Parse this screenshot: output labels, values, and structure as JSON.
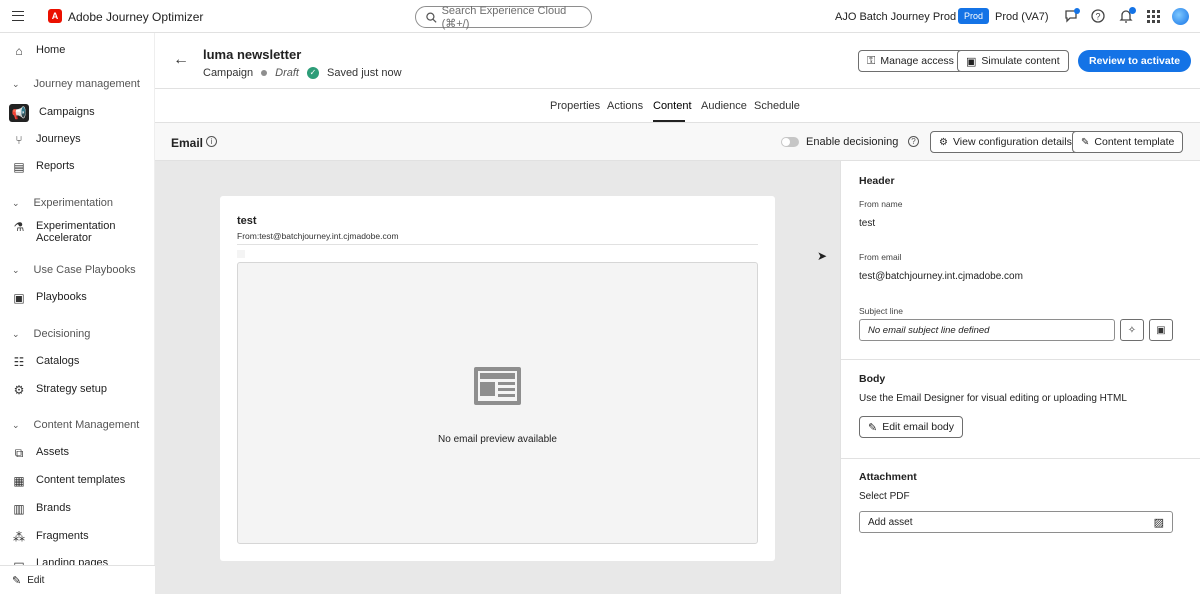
{
  "app": {
    "title": "Adobe Journey Optimizer",
    "search_placeholder": "Search Experience Cloud (⌘+/)",
    "org_name": "AJO Batch Journey Prod",
    "env_badge": "Prod",
    "env_name": "Prod (VA7)"
  },
  "sidebar": {
    "items": {
      "home": "Home",
      "group_journey": "Journey management",
      "campaigns": "Campaigns",
      "journeys": "Journeys",
      "reports": "Reports",
      "group_experimentation": "Experimentation",
      "experimentation_accelerator": "Experimentation Accelerator",
      "group_playbooks": "Use Case Playbooks",
      "playbooks": "Playbooks",
      "group_decisioning": "Decisioning",
      "catalogs": "Catalogs",
      "strategy_setup": "Strategy setup",
      "group_content": "Content Management",
      "assets": "Assets",
      "content_templates": "Content templates",
      "brands": "Brands",
      "fragments": "Fragments",
      "landing_pages": "Landing pages"
    },
    "edit_label": "Edit"
  },
  "campaign": {
    "title": "luma newsletter",
    "type": "Campaign",
    "status": "Draft",
    "saved": "Saved just now"
  },
  "header_buttons": {
    "manage_access": "Manage access",
    "simulate_content": "Simulate content",
    "review": "Review to activate"
  },
  "tabs": [
    "Properties",
    "Actions",
    "Content",
    "Audience",
    "Schedule"
  ],
  "active_tab": "Content",
  "subheader": {
    "title": "Email",
    "decisioning_label": "Enable decisioning",
    "view_config": "View configuration details",
    "content_template": "Content template"
  },
  "email_preview": {
    "subject": "test",
    "from": "From:test@batchjourney.int.cjmadobe.com",
    "empty_text": "No email preview available"
  },
  "panel": {
    "header_title": "Header",
    "from_name_label": "From name",
    "from_name_value": "test",
    "from_email_label": "From email",
    "from_email_value": "test@batchjourney.int.cjmadobe.com",
    "subject_label": "Subject line",
    "subject_placeholder": "No email subject line defined",
    "body_title": "Body",
    "body_desc": "Use the Email Designer for visual editing or uploading HTML",
    "edit_body": "Edit email body",
    "attachment_title": "Attachment",
    "select_pdf": "Select PDF",
    "add_asset": "Add asset"
  }
}
